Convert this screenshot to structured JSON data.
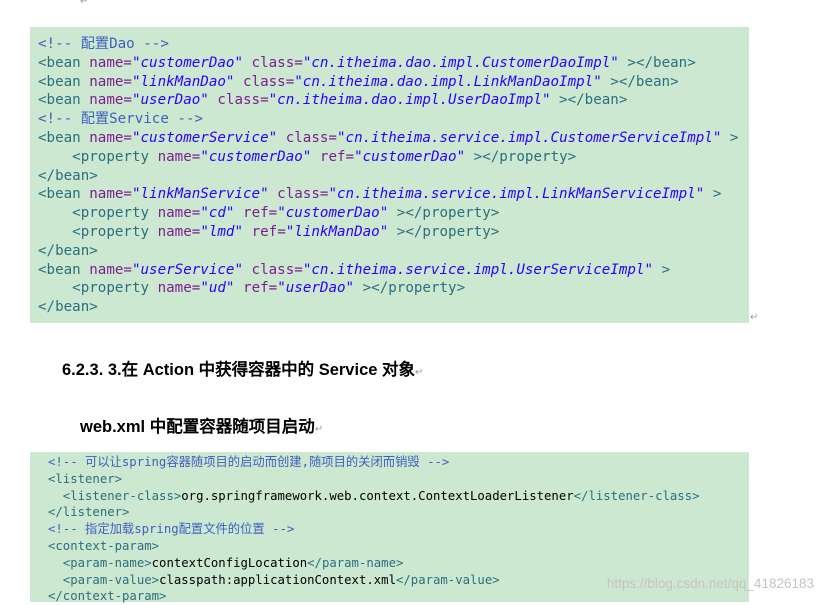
{
  "para_mark": "↵",
  "block1": {
    "lines": [
      [
        "c:<!-- 配置Dao -->"
      ],
      [
        "t:<bean ",
        "a:name=",
        "v:\"customerDao\"",
        "a: class=",
        "v:\"cn.itheima.dao.impl.CustomerDaoImpl\"",
        "t: ></bean>"
      ],
      [
        "t:<bean ",
        "a:name=",
        "v:\"linkManDao\"",
        "a: class=",
        "v:\"cn.itheima.dao.impl.LinkManDaoImpl\"",
        "t: ></bean>"
      ],
      [
        "t:<bean ",
        "a:name=",
        "v:\"userDao\"",
        "a: class=",
        "v:\"cn.itheima.dao.impl.UserDaoImpl\"",
        "t: ></bean>"
      ],
      [
        "c:<!-- 配置Service -->"
      ],
      [
        "t:<bean ",
        "a:name=",
        "v:\"customerService\"",
        "a: class=",
        "v:\"cn.itheima.service.impl.CustomerServiceImpl\"",
        "t: >"
      ],
      [
        "t:    <property ",
        "a:name=",
        "v:\"customerDao\"",
        "a: ref=",
        "v:\"customerDao\"",
        "t: ></property>"
      ],
      [
        "t:</bean>"
      ],
      [
        "t:<bean ",
        "a:name=",
        "v:\"linkManService\"",
        "a: class=",
        "v:\"cn.itheima.service.impl.LinkManServiceImpl\"",
        "t: >"
      ],
      [
        "t:    <property ",
        "a:name=",
        "v:\"cd\"",
        "a: ref=",
        "v:\"customerDao\"",
        "t: ></property>"
      ],
      [
        "t:    <property ",
        "a:name=",
        "v:\"lmd\"",
        "a: ref=",
        "v:\"linkManDao\"",
        "t: ></property>"
      ],
      [
        "t:</bean>"
      ],
      [
        "t:<bean ",
        "a:name=",
        "v:\"userService\"",
        "a: class=",
        "v:\"cn.itheima.service.impl.UserServiceImpl\"",
        "t: >"
      ],
      [
        "t:    <property ",
        "a:name=",
        "v:\"ud\"",
        "a: ref=",
        "v:\"userDao\"",
        "t: ></property>"
      ],
      [
        "t:</bean>"
      ]
    ]
  },
  "heading1": "6.2.3. 3.在 Action 中获得容器中的 Service 对象",
  "heading2": "web.xml 中配置容器随项目启动",
  "block2": {
    "lines": [
      [
        "c:<!-- 可以让spring容器随项目的启动而创建,随项目的关闭而销毁 -->"
      ],
      [
        "t:<listener>"
      ],
      [
        "t:  <listener-class>",
        "x:org.springframework.web.context.ContextLoaderListener",
        "t:</listener-class>"
      ],
      [
        "t:</listener>"
      ],
      [
        "c:<!-- 指定加载spring配置文件的位置 -->"
      ],
      [
        "t:<context-param>"
      ],
      [
        "t:  <param-name>",
        "x:contextConfigLocation",
        "t:</param-name>"
      ],
      [
        "t:  <param-value>",
        "x:classpath:applicationContext.xml",
        "t:</param-value>"
      ],
      [
        "t:</context-param>"
      ]
    ]
  },
  "watermark": "https://blog.csdn.net/qq_41826183"
}
